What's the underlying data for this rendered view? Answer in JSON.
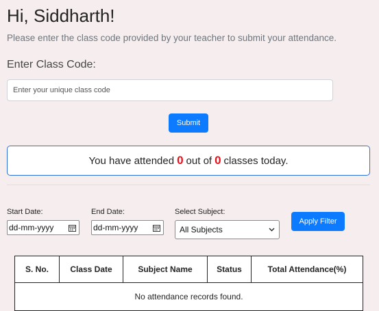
{
  "header": {
    "greeting": "Hi, Siddharth!",
    "subtitle": "Please enter the class code provided by your teacher to submit your attendance."
  },
  "class_code": {
    "label": "Enter Class Code:",
    "placeholder": "Enter your unique class code",
    "value": "",
    "submit_label": "Submit"
  },
  "summary": {
    "prefix": "You have attended",
    "attended": "0",
    "middle": "out of",
    "total": "0",
    "suffix": "classes today."
  },
  "filters": {
    "start_label": "Start Date:",
    "start_value": "dd-mm-yyyy",
    "end_label": "End Date:",
    "end_value": "dd-mm-yyyy",
    "subject_label": "Select Subject:",
    "subject_value": "All Subjects",
    "apply_label": "Apply Filter"
  },
  "table": {
    "headers": [
      "S. No.",
      "Class Date",
      "Subject Name",
      "Status",
      "Total Attendance(%)"
    ],
    "empty_message": "No attendance records found."
  },
  "colors": {
    "background": "#f6eeee",
    "accent": "#0d7bff",
    "highlight": "#e8101b",
    "summary_border": "#2d6fd6"
  },
  "icons": {
    "date_picker": "calendar-icon",
    "select": "chevron-down-icon"
  }
}
